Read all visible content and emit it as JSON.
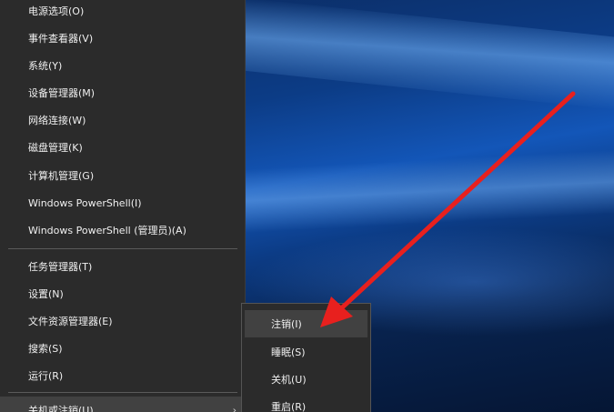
{
  "main_menu": {
    "items": [
      {
        "label": "电源选项(O)"
      },
      {
        "label": "事件查看器(V)"
      },
      {
        "label": "系统(Y)"
      },
      {
        "label": "设备管理器(M)"
      },
      {
        "label": "网络连接(W)"
      },
      {
        "label": "磁盘管理(K)"
      },
      {
        "label": "计算机管理(G)"
      },
      {
        "label": "Windows PowerShell(I)"
      },
      {
        "label": "Windows PowerShell (管理员)(A)"
      },
      {
        "label": "任务管理器(T)"
      },
      {
        "label": "设置(N)"
      },
      {
        "label": "文件资源管理器(E)"
      },
      {
        "label": "搜索(S)"
      },
      {
        "label": "运行(R)"
      },
      {
        "label": "关机或注销(U)",
        "chevron": "›"
      }
    ]
  },
  "submenu": {
    "items": [
      {
        "label": "注销(I)"
      },
      {
        "label": "睡眠(S)"
      },
      {
        "label": "关机(U)"
      },
      {
        "label": "重启(R)"
      }
    ]
  },
  "colors": {
    "menu_bg": "#2b2b2b",
    "highlight": "#414141",
    "annotation_arrow": "#e8201e"
  },
  "icons": {
    "submenu_indicator": "chevron-right-icon",
    "annotation": "red-arrow-icon"
  }
}
